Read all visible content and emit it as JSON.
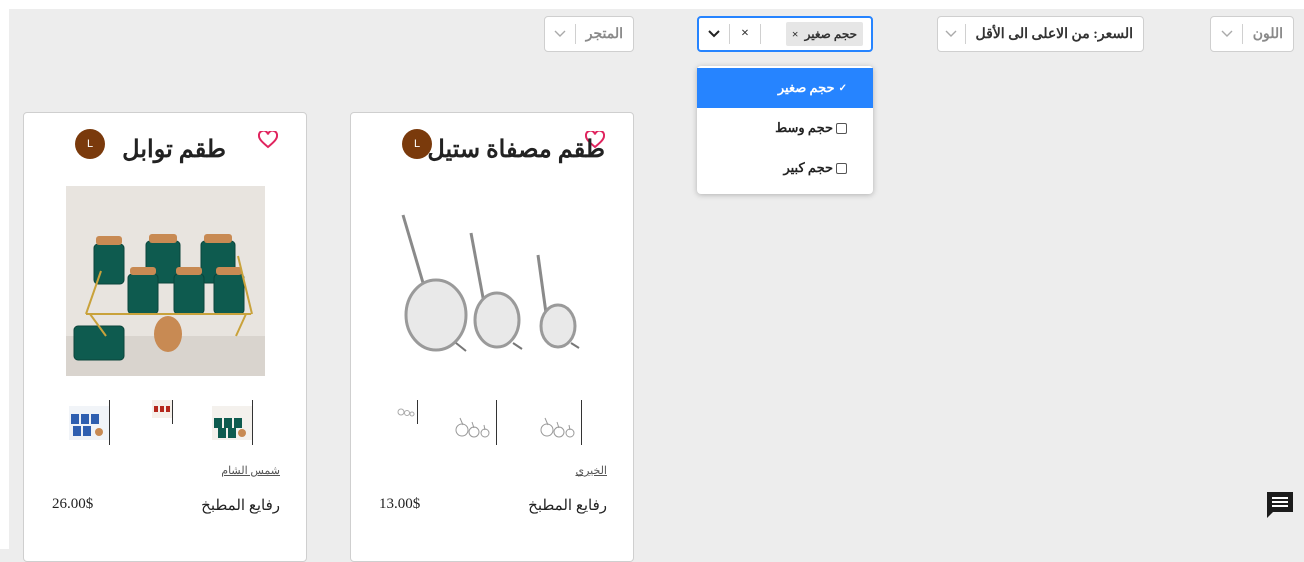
{
  "filters": {
    "color": {
      "label": "اللون"
    },
    "price": {
      "label": "السعر: من الاعلى الى الأقل"
    },
    "size": {
      "chip_label": "حجم صغير",
      "chip_remove": "×",
      "clear": "×"
    },
    "store": {
      "label": "المتجر"
    }
  },
  "size_menu": {
    "options": [
      {
        "label": "حجم صغير",
        "selected": true,
        "mark": "✓"
      },
      {
        "label": "حجم وسط",
        "selected": false
      },
      {
        "label": "حجم كبير",
        "selected": false
      }
    ]
  },
  "products": [
    {
      "title": "طقم مصفاة ستيل",
      "badge": "L",
      "store": "الخيري",
      "category": "رفايع المطبخ",
      "price": "13.00$"
    },
    {
      "title": "طقم توابل",
      "badge": "L",
      "store": "شمس الشام",
      "category": "رفايع المطبخ",
      "price": "26.00$"
    }
  ],
  "colors": {
    "accent": "#2684ff",
    "badge": "#7a3a0c",
    "heart": "#e0245e",
    "jar_green": "#0e5b4f"
  },
  "icons": [
    "chevron-down-icon",
    "close-icon",
    "heart-icon",
    "chat-icon"
  ]
}
